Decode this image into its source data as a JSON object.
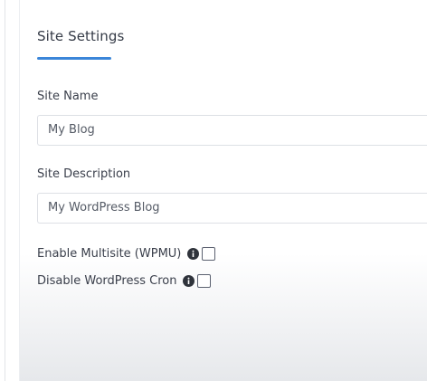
{
  "panel": {
    "title": "Site Settings"
  },
  "fields": {
    "site_name": {
      "label": "Site Name",
      "value": "My Blog"
    },
    "site_description": {
      "label": "Site Description",
      "value": "My WordPress Blog"
    }
  },
  "options": {
    "multisite": {
      "label": "Enable Multisite (WPMU)",
      "checked": false
    },
    "disable_cron": {
      "label": "Disable WordPress Cron",
      "checked": false
    }
  },
  "icons": {
    "info": "info-circle-icon"
  },
  "colors": {
    "accent": "#3b86d9"
  }
}
